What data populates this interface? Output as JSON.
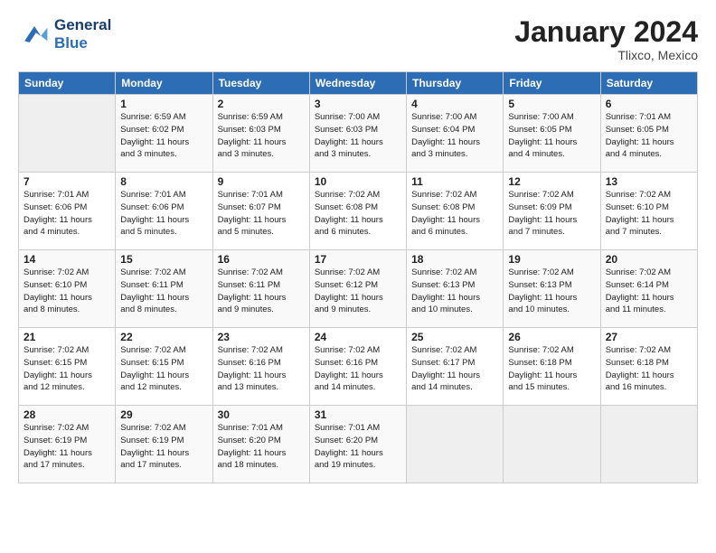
{
  "header": {
    "logo_line1": "General",
    "logo_line2": "Blue",
    "month": "January 2024",
    "location": "Tlixco, Mexico"
  },
  "weekdays": [
    "Sunday",
    "Monday",
    "Tuesday",
    "Wednesday",
    "Thursday",
    "Friday",
    "Saturday"
  ],
  "weeks": [
    [
      {
        "day": "",
        "info": ""
      },
      {
        "day": "1",
        "info": "Sunrise: 6:59 AM\nSunset: 6:02 PM\nDaylight: 11 hours\nand 3 minutes."
      },
      {
        "day": "2",
        "info": "Sunrise: 6:59 AM\nSunset: 6:03 PM\nDaylight: 11 hours\nand 3 minutes."
      },
      {
        "day": "3",
        "info": "Sunrise: 7:00 AM\nSunset: 6:03 PM\nDaylight: 11 hours\nand 3 minutes."
      },
      {
        "day": "4",
        "info": "Sunrise: 7:00 AM\nSunset: 6:04 PM\nDaylight: 11 hours\nand 3 minutes."
      },
      {
        "day": "5",
        "info": "Sunrise: 7:00 AM\nSunset: 6:05 PM\nDaylight: 11 hours\nand 4 minutes."
      },
      {
        "day": "6",
        "info": "Sunrise: 7:01 AM\nSunset: 6:05 PM\nDaylight: 11 hours\nand 4 minutes."
      }
    ],
    [
      {
        "day": "7",
        "info": "Sunrise: 7:01 AM\nSunset: 6:06 PM\nDaylight: 11 hours\nand 4 minutes."
      },
      {
        "day": "8",
        "info": "Sunrise: 7:01 AM\nSunset: 6:06 PM\nDaylight: 11 hours\nand 5 minutes."
      },
      {
        "day": "9",
        "info": "Sunrise: 7:01 AM\nSunset: 6:07 PM\nDaylight: 11 hours\nand 5 minutes."
      },
      {
        "day": "10",
        "info": "Sunrise: 7:02 AM\nSunset: 6:08 PM\nDaylight: 11 hours\nand 6 minutes."
      },
      {
        "day": "11",
        "info": "Sunrise: 7:02 AM\nSunset: 6:08 PM\nDaylight: 11 hours\nand 6 minutes."
      },
      {
        "day": "12",
        "info": "Sunrise: 7:02 AM\nSunset: 6:09 PM\nDaylight: 11 hours\nand 7 minutes."
      },
      {
        "day": "13",
        "info": "Sunrise: 7:02 AM\nSunset: 6:10 PM\nDaylight: 11 hours\nand 7 minutes."
      }
    ],
    [
      {
        "day": "14",
        "info": "Sunrise: 7:02 AM\nSunset: 6:10 PM\nDaylight: 11 hours\nand 8 minutes."
      },
      {
        "day": "15",
        "info": "Sunrise: 7:02 AM\nSunset: 6:11 PM\nDaylight: 11 hours\nand 8 minutes."
      },
      {
        "day": "16",
        "info": "Sunrise: 7:02 AM\nSunset: 6:11 PM\nDaylight: 11 hours\nand 9 minutes."
      },
      {
        "day": "17",
        "info": "Sunrise: 7:02 AM\nSunset: 6:12 PM\nDaylight: 11 hours\nand 9 minutes."
      },
      {
        "day": "18",
        "info": "Sunrise: 7:02 AM\nSunset: 6:13 PM\nDaylight: 11 hours\nand 10 minutes."
      },
      {
        "day": "19",
        "info": "Sunrise: 7:02 AM\nSunset: 6:13 PM\nDaylight: 11 hours\nand 10 minutes."
      },
      {
        "day": "20",
        "info": "Sunrise: 7:02 AM\nSunset: 6:14 PM\nDaylight: 11 hours\nand 11 minutes."
      }
    ],
    [
      {
        "day": "21",
        "info": "Sunrise: 7:02 AM\nSunset: 6:15 PM\nDaylight: 11 hours\nand 12 minutes."
      },
      {
        "day": "22",
        "info": "Sunrise: 7:02 AM\nSunset: 6:15 PM\nDaylight: 11 hours\nand 12 minutes."
      },
      {
        "day": "23",
        "info": "Sunrise: 7:02 AM\nSunset: 6:16 PM\nDaylight: 11 hours\nand 13 minutes."
      },
      {
        "day": "24",
        "info": "Sunrise: 7:02 AM\nSunset: 6:16 PM\nDaylight: 11 hours\nand 14 minutes."
      },
      {
        "day": "25",
        "info": "Sunrise: 7:02 AM\nSunset: 6:17 PM\nDaylight: 11 hours\nand 14 minutes."
      },
      {
        "day": "26",
        "info": "Sunrise: 7:02 AM\nSunset: 6:18 PM\nDaylight: 11 hours\nand 15 minutes."
      },
      {
        "day": "27",
        "info": "Sunrise: 7:02 AM\nSunset: 6:18 PM\nDaylight: 11 hours\nand 16 minutes."
      }
    ],
    [
      {
        "day": "28",
        "info": "Sunrise: 7:02 AM\nSunset: 6:19 PM\nDaylight: 11 hours\nand 17 minutes."
      },
      {
        "day": "29",
        "info": "Sunrise: 7:02 AM\nSunset: 6:19 PM\nDaylight: 11 hours\nand 17 minutes."
      },
      {
        "day": "30",
        "info": "Sunrise: 7:01 AM\nSunset: 6:20 PM\nDaylight: 11 hours\nand 18 minutes."
      },
      {
        "day": "31",
        "info": "Sunrise: 7:01 AM\nSunset: 6:20 PM\nDaylight: 11 hours\nand 19 minutes."
      },
      {
        "day": "",
        "info": ""
      },
      {
        "day": "",
        "info": ""
      },
      {
        "day": "",
        "info": ""
      }
    ]
  ]
}
